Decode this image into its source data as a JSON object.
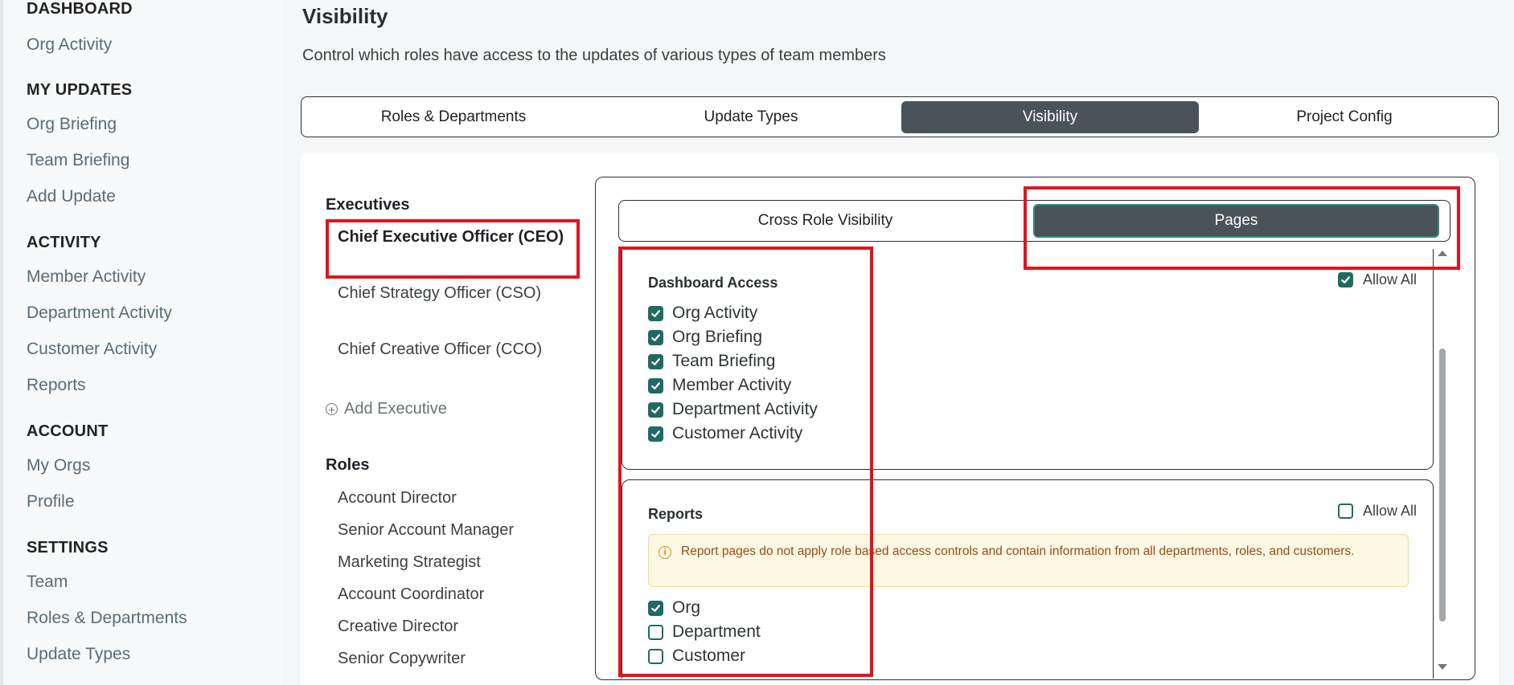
{
  "sidebar": {
    "sections": [
      {
        "heading": "DASHBOARD",
        "items": [
          "Org Activity"
        ]
      },
      {
        "heading": "MY UPDATES",
        "items": [
          "Org Briefing",
          "Team Briefing",
          "Add Update"
        ]
      },
      {
        "heading": "ACTIVITY",
        "items": [
          "Member Activity",
          "Department Activity",
          "Customer Activity",
          "Reports"
        ]
      },
      {
        "heading": "ACCOUNT",
        "items": [
          "My Orgs",
          "Profile"
        ]
      },
      {
        "heading": "SETTINGS",
        "items": [
          "Team",
          "Roles & Departments",
          "Update Types"
        ]
      }
    ]
  },
  "header": {
    "title": "Visibility",
    "subtitle": "Control which roles have access to the updates of various types of team members"
  },
  "tabs": [
    {
      "label": "Roles & Departments",
      "active": false
    },
    {
      "label": "Update Types",
      "active": false
    },
    {
      "label": "Visibility",
      "active": true
    },
    {
      "label": "Project Config",
      "active": false
    }
  ],
  "roles_column": {
    "executives_heading": "Executives",
    "executives": [
      {
        "label": "Chief Executive Officer (CEO)",
        "selected": true
      },
      {
        "label": "Chief Strategy Officer (CSO)",
        "selected": false
      },
      {
        "label": "Chief Creative Officer (CCO)",
        "selected": false
      }
    ],
    "add_executive_label": "Add Executive",
    "roles_heading": "Roles",
    "roles": [
      "Account Director",
      "Senior Account Manager",
      "Marketing Strategist",
      "Account Coordinator",
      "Creative Director",
      "Senior Copywriter"
    ]
  },
  "subtabs": [
    {
      "label": "Cross Role Visibility",
      "active": false
    },
    {
      "label": "Pages",
      "active": true
    }
  ],
  "dashboard_access": {
    "title": "Dashboard Access",
    "allow_all_label": "Allow All",
    "allow_all_checked": true,
    "items": [
      {
        "label": "Org Activity",
        "checked": true
      },
      {
        "label": "Org Briefing",
        "checked": true
      },
      {
        "label": "Team Briefing",
        "checked": true
      },
      {
        "label": "Member Activity",
        "checked": true
      },
      {
        "label": "Department Activity",
        "checked": true
      },
      {
        "label": "Customer Activity",
        "checked": true
      }
    ]
  },
  "reports": {
    "title": "Reports",
    "allow_all_label": "Allow All",
    "allow_all_checked": false,
    "notice": "Report pages do not apply role based access controls and contain information from all departments, roles, and customers.",
    "items": [
      {
        "label": "Org",
        "checked": true
      },
      {
        "label": "Department",
        "checked": false
      },
      {
        "label": "Customer",
        "checked": false
      }
    ]
  },
  "colors": {
    "accent": "#1f6b63",
    "active_tab": "#4a5358",
    "annotation_red": "#e0141e",
    "notice_bg": "#fdf8e4",
    "notice_text": "#9c4a12"
  }
}
